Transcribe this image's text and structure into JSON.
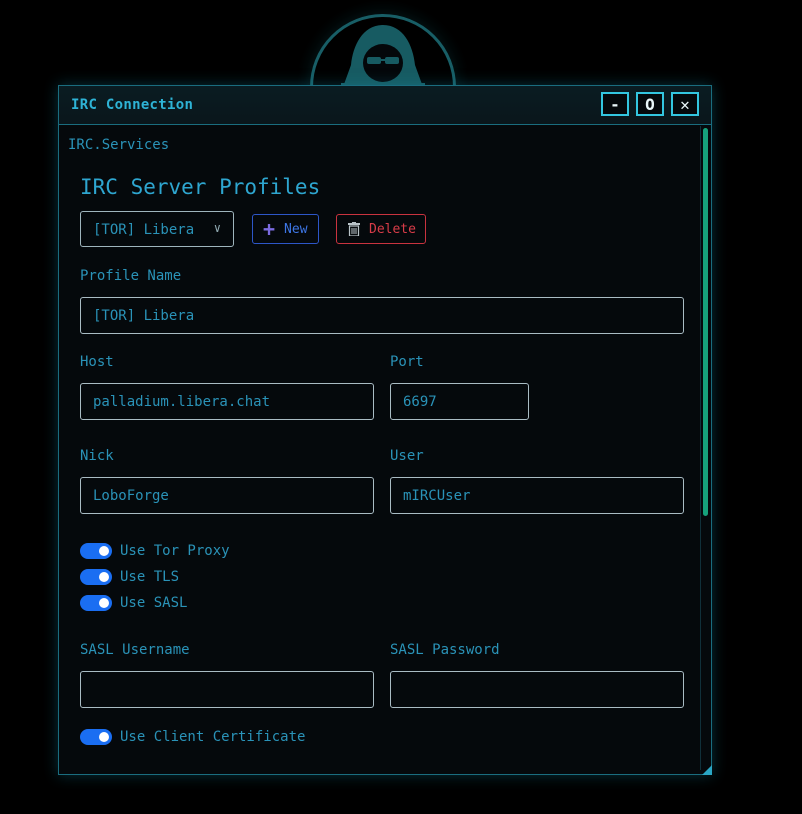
{
  "window": {
    "title": "IRC Connection",
    "min_label": "-",
    "max_label": "O",
    "close_label": "✕"
  },
  "section": "IRC.Services",
  "heading": "IRC Server Profiles",
  "profile_select": {
    "selected": "[TOR] Libera"
  },
  "buttons": {
    "new_label": "New",
    "delete_label": "Delete"
  },
  "fields": {
    "profile_name": {
      "label": "Profile Name",
      "value": "[TOR] Libera"
    },
    "host": {
      "label": "Host",
      "value": "palladium.libera.chat"
    },
    "port": {
      "label": "Port",
      "value": "6697"
    },
    "nick": {
      "label": "Nick",
      "value": "LoboForge"
    },
    "user": {
      "label": "User",
      "value": "mIRCUser"
    },
    "sasl_username": {
      "label": "SASL Username",
      "value": ""
    },
    "sasl_password": {
      "label": "SASL Password",
      "value": ""
    }
  },
  "toggles": {
    "tor": {
      "label": "Use Tor Proxy",
      "on": true
    },
    "tls": {
      "label": "Use TLS",
      "on": true
    },
    "sasl": {
      "label": "Use SASL",
      "on": true
    },
    "cert": {
      "label": "Use Client Certificate",
      "on": true
    }
  },
  "colors": {
    "accent": "#2a93b8",
    "toggle_on": "#1a6ef2",
    "danger": "#d93c48",
    "scroll": "#16a27c"
  }
}
